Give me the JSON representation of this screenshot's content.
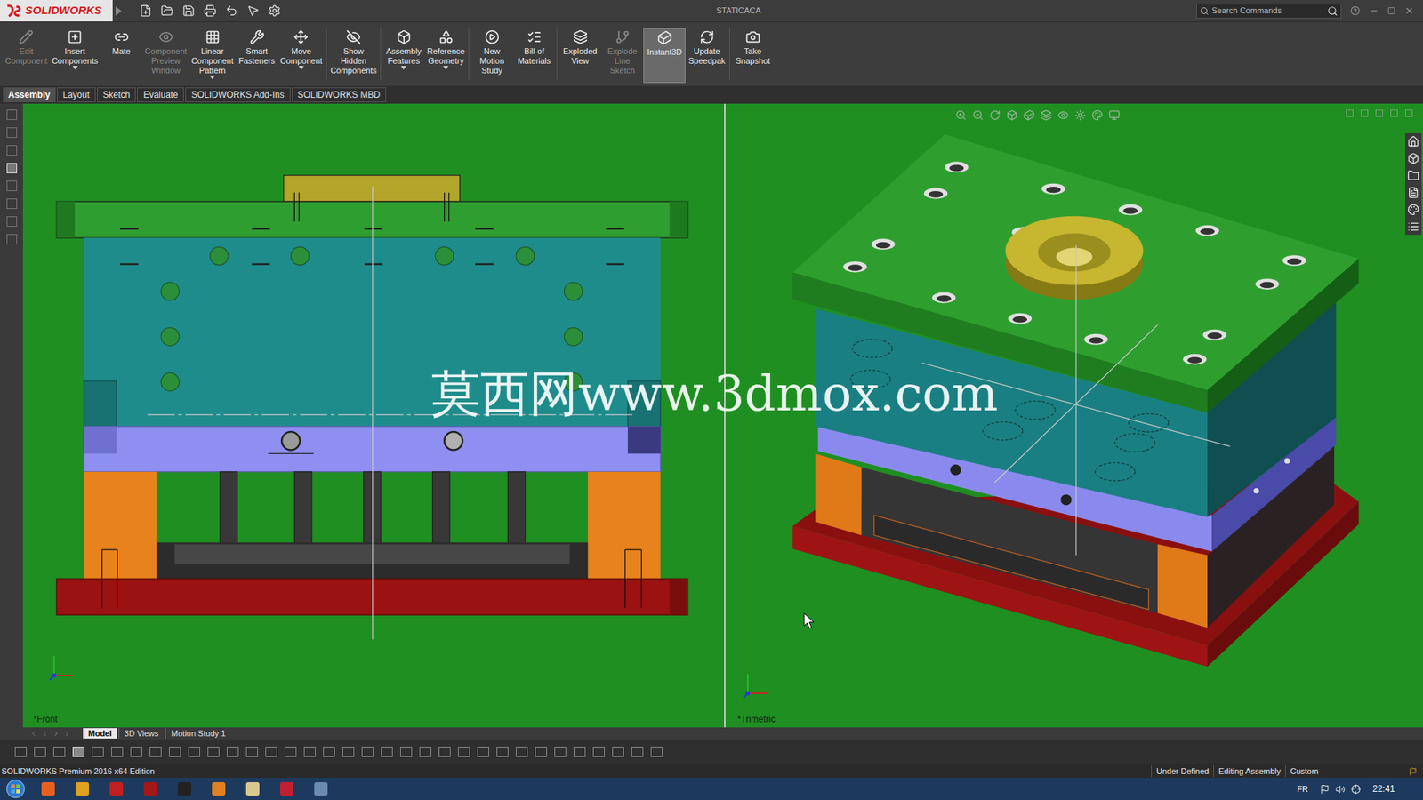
{
  "window": {
    "logo": "SOLIDWORKS",
    "title": "STATICACA",
    "search": {
      "placeholder": "Search Commands"
    }
  },
  "ribbon": [
    {
      "lines": [
        "Edit",
        "Component"
      ],
      "disabled": true,
      "selected": false,
      "dropdown": false,
      "separator_after": false
    },
    {
      "lines": [
        "Insert",
        "Components"
      ],
      "disabled": false,
      "selected": false,
      "dropdown": true,
      "separator_after": false
    },
    {
      "lines": [
        "Mate"
      ],
      "disabled": false,
      "selected": false,
      "dropdown": false,
      "separator_after": false
    },
    {
      "lines": [
        "Component",
        "Preview",
        "Window"
      ],
      "disabled": true,
      "selected": false,
      "dropdown": false,
      "separator_after": false
    },
    {
      "lines": [
        "Linear",
        "Component",
        "Pattern"
      ],
      "disabled": false,
      "selected": false,
      "dropdown": true,
      "separator_after": false
    },
    {
      "lines": [
        "Smart",
        "Fasteners"
      ],
      "disabled": false,
      "selected": false,
      "dropdown": false,
      "separator_after": false
    },
    {
      "lines": [
        "Move",
        "Component"
      ],
      "disabled": false,
      "selected": false,
      "dropdown": true,
      "separator_after": true
    },
    {
      "lines": [
        "Show",
        "Hidden",
        "Components"
      ],
      "disabled": false,
      "selected": false,
      "dropdown": false,
      "separator_after": true
    },
    {
      "lines": [
        "Assembly",
        "Features"
      ],
      "disabled": false,
      "selected": false,
      "dropdown": true,
      "separator_after": false
    },
    {
      "lines": [
        "Reference",
        "Geometry"
      ],
      "disabled": false,
      "selected": false,
      "dropdown": true,
      "separator_after": true
    },
    {
      "lines": [
        "New",
        "Motion",
        "Study"
      ],
      "disabled": false,
      "selected": false,
      "dropdown": false,
      "separator_after": false
    },
    {
      "lines": [
        "Bill of",
        "Materials"
      ],
      "disabled": false,
      "selected": false,
      "dropdown": false,
      "separator_after": true
    },
    {
      "lines": [
        "Exploded",
        "View"
      ],
      "disabled": false,
      "selected": false,
      "dropdown": false,
      "separator_after": false
    },
    {
      "lines": [
        "Explode",
        "Line",
        "Sketch"
      ],
      "disabled": true,
      "selected": false,
      "dropdown": false,
      "separator_after": false
    },
    {
      "lines": [
        "Instant3D"
      ],
      "disabled": false,
      "selected": true,
      "dropdown": false,
      "separator_after": false
    },
    {
      "lines": [
        "Update",
        "Speedpak"
      ],
      "disabled": false,
      "selected": false,
      "dropdown": false,
      "separator_after": true
    },
    {
      "lines": [
        "Take",
        "Snapshot"
      ],
      "disabled": false,
      "selected": false,
      "dropdown": false,
      "separator_after": false
    }
  ],
  "tabs": [
    {
      "label": "Assembly",
      "selected": true
    },
    {
      "label": "Layout",
      "selected": false
    },
    {
      "label": "Sketch",
      "selected": false
    },
    {
      "label": "Evaluate",
      "selected": false
    },
    {
      "label": "SOLIDWORKS Add-Ins",
      "selected": false
    },
    {
      "label": "SOLIDWORKS MBD",
      "selected": false
    }
  ],
  "viewports": [
    {
      "label": "*Front"
    },
    {
      "label": "*Trimetric"
    }
  ],
  "watermark": "莫西网www.3dmox.com",
  "bottom_tabs": [
    {
      "label": "Model",
      "selected": true
    },
    {
      "label": "3D Views",
      "selected": false
    },
    {
      "label": "Motion Study 1",
      "selected": false
    }
  ],
  "status_bar": {
    "product": "SOLIDWORKS Premium 2016 x64 Edition",
    "fields": [
      "Under Defined",
      "Editing Assembly",
      "Custom"
    ]
  },
  "taskbar": {
    "language": "FR",
    "time": "22:41"
  }
}
